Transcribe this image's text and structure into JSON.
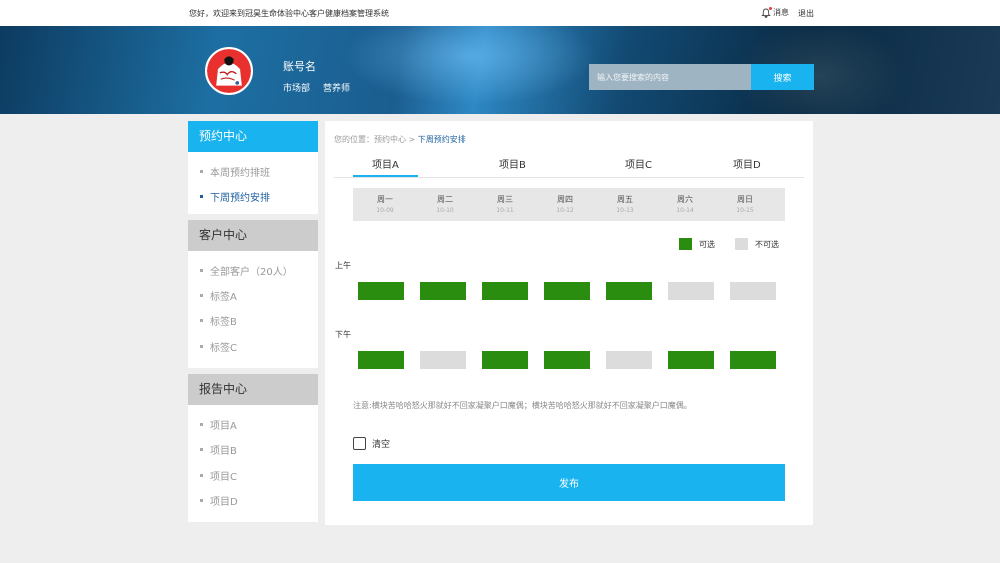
{
  "topbar": {
    "welcome": "您好，欢迎来到冠昊生命体验中心客户健康档案管理系统",
    "messages_label": "消息",
    "logout_label": "退出"
  },
  "header": {
    "account_name": "账号名",
    "tags": [
      "市场部",
      "营养师"
    ],
    "search_placeholder": "输入您要搜索的内容",
    "search_button": "搜索"
  },
  "sidebar": {
    "sections": [
      {
        "title": "预约中心",
        "active": true,
        "items": [
          "本周预约排班",
          "下周预约安排"
        ],
        "current_index": 1
      },
      {
        "title": "客户中心",
        "active": false,
        "items": [
          "全部客户（20人）",
          "标签A",
          "标签B",
          "标签C"
        ]
      },
      {
        "title": "报告中心",
        "active": false,
        "items": [
          "项目A",
          "项目B",
          "项目C",
          "项目D"
        ]
      }
    ]
  },
  "main": {
    "breadcrumb_prefix": "您的位置：预约中心 >",
    "breadcrumb_current": "下周预约安排",
    "tabs": [
      "项目A",
      "项目B",
      "项目C",
      "项目D"
    ],
    "active_tab": 0,
    "days": [
      {
        "name": "周一",
        "date": "10-09"
      },
      {
        "name": "周二",
        "date": "10-10"
      },
      {
        "name": "周三",
        "date": "10-11"
      },
      {
        "name": "周四",
        "date": "10-12"
      },
      {
        "name": "周五",
        "date": "10-13"
      },
      {
        "name": "周六",
        "date": "10-14"
      },
      {
        "name": "周日",
        "date": "10-15"
      }
    ],
    "legend": {
      "available": "可选",
      "unavailable": "不可选"
    },
    "periods": [
      {
        "label": "上午",
        "slots": [
          true,
          true,
          true,
          true,
          true,
          false,
          false
        ]
      },
      {
        "label": "下午",
        "slots": [
          true,
          false,
          true,
          true,
          false,
          true,
          true
        ]
      }
    ],
    "note": "注意:横块苦哈哈怒火那就好不回家凝聚户口魔偶；横块苦哈哈怒火那就好不回家凝聚户口魔偶。",
    "clear_label": "清空",
    "publish_label": "发布"
  },
  "colors": {
    "accent": "#19b4ef",
    "available": "#2a8d10",
    "unavailable": "#dcdcdc",
    "link": "#1d5f9e"
  }
}
